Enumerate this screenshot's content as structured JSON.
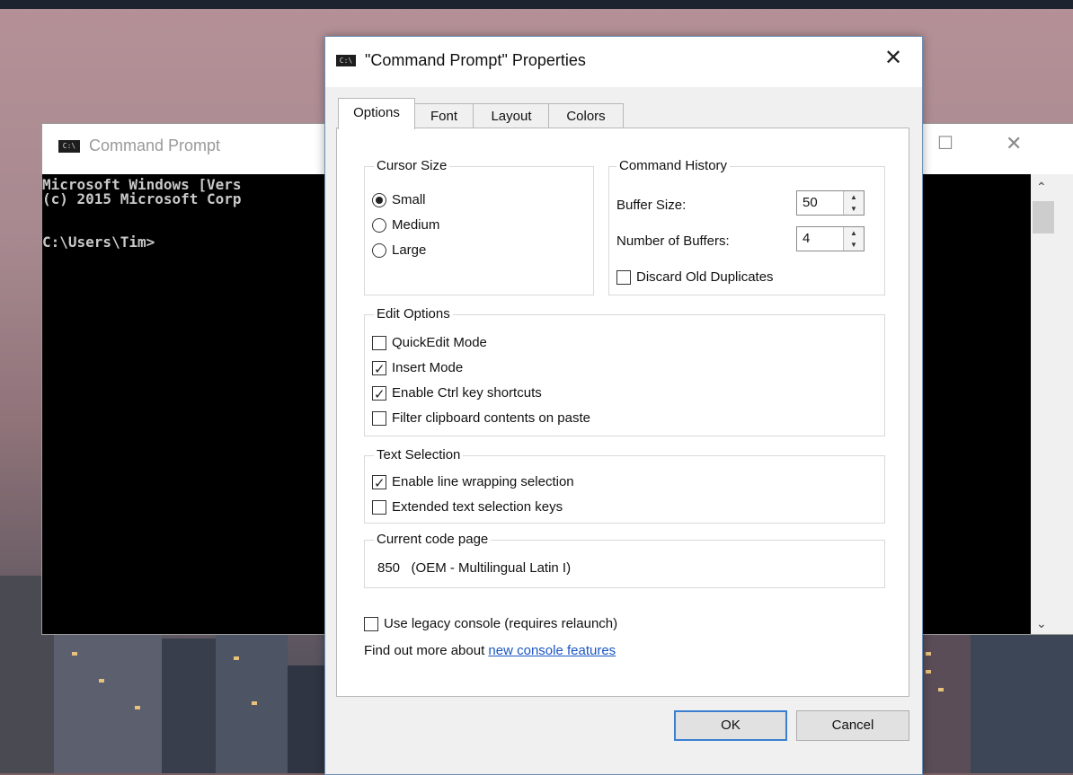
{
  "cmd_window": {
    "title": "Command Prompt",
    "icon": "cmd-icon",
    "console_lines": [
      "Microsoft Windows [Vers",
      "(c) 2015 Microsoft Corp",
      "",
      "C:\\Users\\Tim>"
    ]
  },
  "dialog": {
    "title": "\"Command Prompt\" Properties",
    "tabs": [
      {
        "label": "Options",
        "active": true
      },
      {
        "label": "Font",
        "active": false
      },
      {
        "label": "Layout",
        "active": false
      },
      {
        "label": "Colors",
        "active": false
      }
    ],
    "cursor_size": {
      "legend": "Cursor Size",
      "options": [
        {
          "label": "Small",
          "selected": true
        },
        {
          "label": "Medium",
          "selected": false
        },
        {
          "label": "Large",
          "selected": false
        }
      ]
    },
    "command_history": {
      "legend": "Command History",
      "buffer_size_label": "Buffer Size:",
      "buffer_size_value": "50",
      "num_buffers_label": "Number of Buffers:",
      "num_buffers_value": "4",
      "discard_label": "Discard Old Duplicates",
      "discard_checked": false
    },
    "edit_options": {
      "legend": "Edit Options",
      "items": [
        {
          "label": "QuickEdit Mode",
          "checked": false
        },
        {
          "label": "Insert Mode",
          "checked": true
        },
        {
          "label": "Enable Ctrl key shortcuts",
          "checked": true
        },
        {
          "label": "Filter clipboard contents on paste",
          "checked": false
        }
      ]
    },
    "text_selection": {
      "legend": "Text Selection",
      "items": [
        {
          "label": "Enable line wrapping selection",
          "checked": true
        },
        {
          "label": "Extended text selection keys",
          "checked": false
        }
      ]
    },
    "code_page": {
      "legend": "Current code page",
      "value": "850   (OEM - Multilingual Latin I)"
    },
    "legacy_console": {
      "label": "Use legacy console (requires relaunch)",
      "checked": false
    },
    "find_more": {
      "prefix": "Find out more about ",
      "link_text": "new console features"
    },
    "buttons": {
      "ok": "OK",
      "cancel": "Cancel"
    }
  }
}
